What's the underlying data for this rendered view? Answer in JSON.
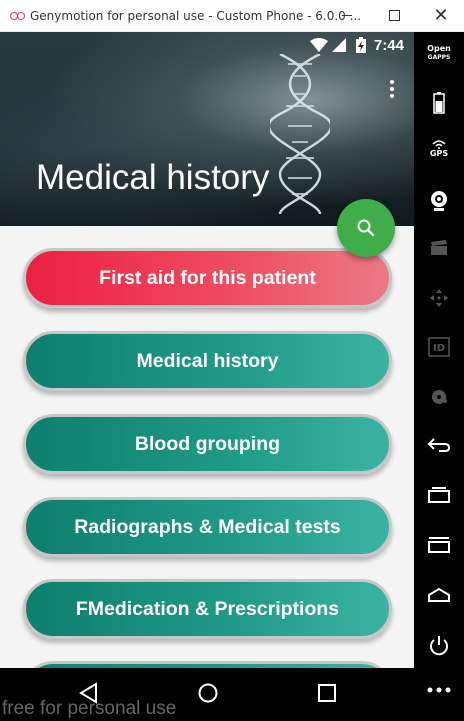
{
  "window": {
    "title": "Genymotion for personal use - Custom Phone - 6.0.0 ..."
  },
  "statusbar": {
    "time": "7:44"
  },
  "header": {
    "title": "Medical history"
  },
  "menu": [
    {
      "label": "First aid for this patient",
      "style": "red"
    },
    {
      "label": "Medical history",
      "style": "teal"
    },
    {
      "label": "Blood grouping",
      "style": "teal"
    },
    {
      "label": "Radiographs & Medical tests",
      "style": "teal"
    },
    {
      "label": "FMedication & Prescriptions",
      "style": "teal"
    }
  ],
  "toolbar": {
    "opengapps_label_1": "Open",
    "opengapps_label_2": "GAPPS",
    "gps_label": "GPS",
    "id_label": "ID"
  },
  "watermark": "free for personal use",
  "colors": {
    "accent_red": "#ec2040",
    "accent_teal": "#1f9985",
    "fab_green": "#3fae4a"
  }
}
